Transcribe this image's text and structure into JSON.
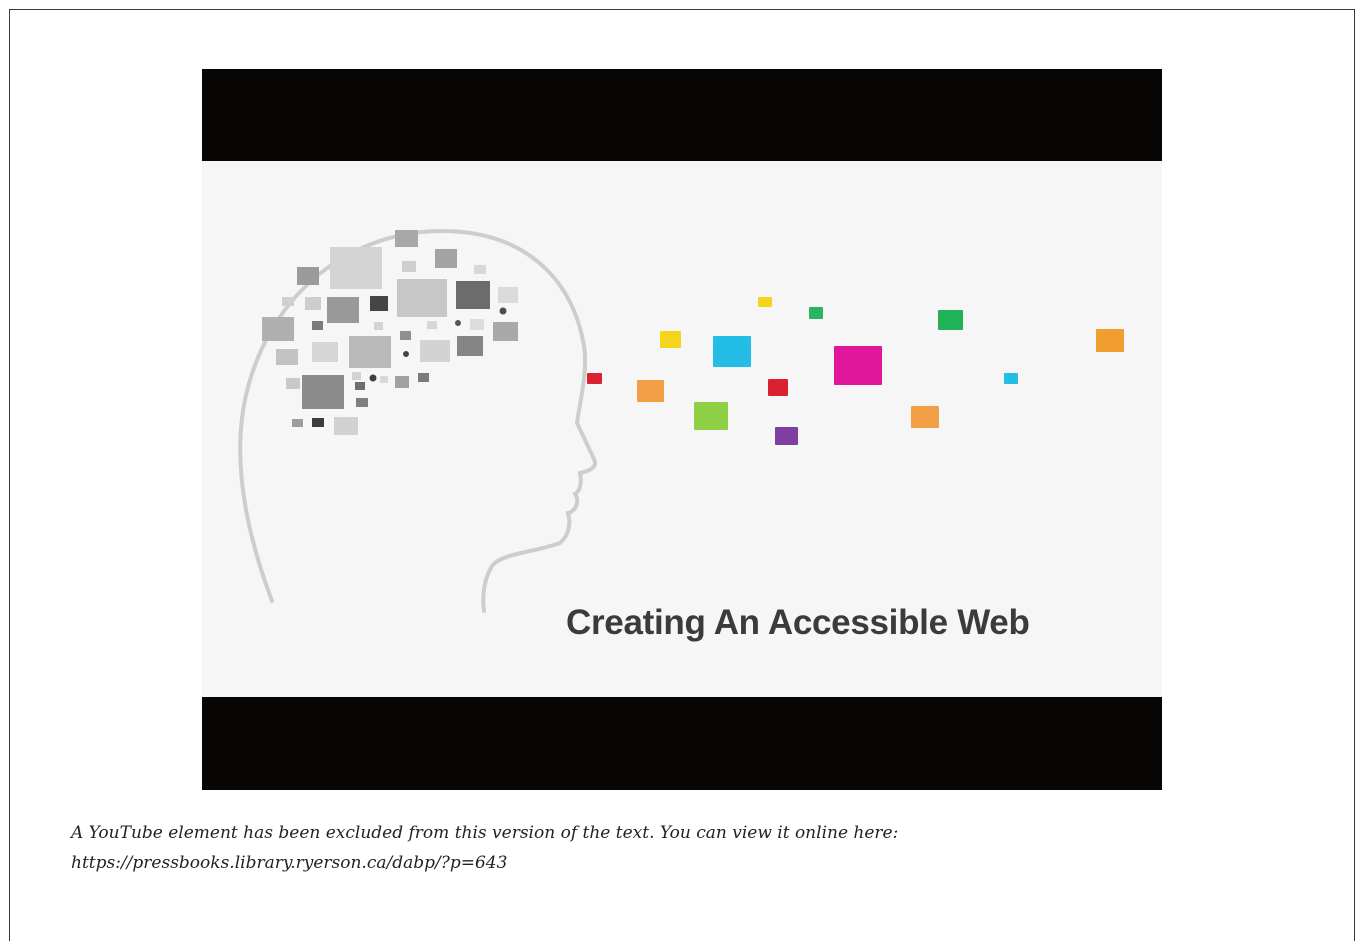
{
  "video": {
    "title_text": "Creating An Accessible Web"
  },
  "caption": {
    "line1": "A YouTube element has been excluded from this version of the text. You can view it online here:",
    "line2": "https://pressbooks.library.ryerson.ca/dabp/?p=643"
  },
  "colors": {
    "letterbox": "#070605",
    "frame_bg": "#f6f6f6",
    "title": "#3b3b3b",
    "caption": "#222222"
  }
}
